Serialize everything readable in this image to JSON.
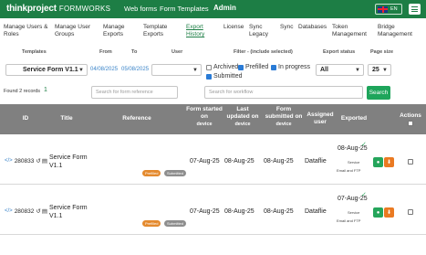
{
  "app": {
    "brand": "thinkproject",
    "product": "FORMWORKS",
    "nav": [
      "Web forms",
      "Form Templates",
      "Admin"
    ],
    "lang": "EN"
  },
  "subnav": [
    "Manage Users & Roles",
    "Manage User Groups",
    "Manage Exports",
    "Template Exports",
    "Export History",
    "License",
    "Sync Legacy",
    "Sync",
    "Databases",
    "Token Management",
    "Bridge Management"
  ],
  "active_subnav": "Export History",
  "filters": {
    "labels": {
      "templates": "Templates",
      "from": "From",
      "to": "To",
      "user": "User",
      "filter": "Filter - (include selected)",
      "status": "Export status",
      "pagesize": "Page size"
    },
    "template_value": "Service Form V1.1",
    "from_date": "04/08/2025",
    "to_date": "05/08/2025",
    "user_value": "",
    "checks": [
      {
        "label": "Archived",
        "checked": false
      },
      {
        "label": "Prefilled",
        "checked": true
      },
      {
        "label": "In progress",
        "checked": true
      },
      {
        "label": "Submitted",
        "checked": true
      }
    ],
    "status_value": "All",
    "pagesize_value": "25"
  },
  "found_label": "Found 2 records",
  "found_count": "1",
  "search_form_placeholder": "Search for form reference",
  "search_workflow_placeholder": "Search for workflow",
  "search_button": "Search",
  "table": {
    "headers": {
      "id": "ID",
      "title": "Title",
      "reference": "Reference",
      "started": "Form started on",
      "started_sub": "device",
      "updated": "Last updated on",
      "updated_sub": "device",
      "submitted": "Form submitted on",
      "submitted_sub": "device",
      "user": "Assigned user",
      "exported": "Exported",
      "actions": "Actions"
    },
    "rows": [
      {
        "link_icon": "</>",
        "id": "280833",
        "title": "Service Form V1.1",
        "badges": [
          "Prefilled",
          "Submitted"
        ],
        "started": "07-Aug-25",
        "updated": "08-Aug-25",
        "submitted": "08-Aug-25",
        "user": "Dataflie",
        "exported": "08-Aug-25",
        "service": "Service",
        "channels": "Email and FTP"
      },
      {
        "link_icon": "</>",
        "id": "280832",
        "title": "Service Form V1.1",
        "badges": [
          "Prefilled",
          "Submitted"
        ],
        "started": "07-Aug-25",
        "updated": "08-Aug-25",
        "submitted": "08-Aug-25",
        "user": "Dataflie",
        "exported": "07-Aug-25",
        "service": "Service",
        "channels": "Email and FTP"
      }
    ]
  },
  "colors": {
    "brand_green": "#1d7e45",
    "header_gray": "#808080",
    "prefilled": "#e48a2e",
    "submitted": "#8e8e8e"
  }
}
